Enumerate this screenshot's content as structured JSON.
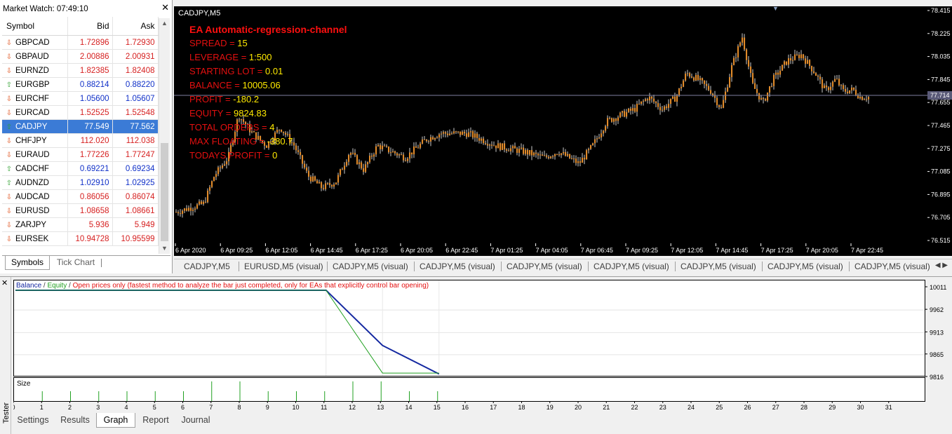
{
  "market_watch": {
    "title": "Market Watch: 07:49:10",
    "columns": {
      "symbol": "Symbol",
      "bid": "Bid",
      "ask": "Ask"
    },
    "rows": [
      {
        "symbol": "GBPCAD",
        "bid": "1.72896",
        "ask": "1.72930",
        "dir": "down",
        "color": "red"
      },
      {
        "symbol": "GBPAUD",
        "bid": "2.00886",
        "ask": "2.00931",
        "dir": "down",
        "color": "red"
      },
      {
        "symbol": "EURNZD",
        "bid": "1.82385",
        "ask": "1.82408",
        "dir": "down",
        "color": "red"
      },
      {
        "symbol": "EURGBP",
        "bid": "0.88214",
        "ask": "0.88220",
        "dir": "up",
        "color": "blue"
      },
      {
        "symbol": "EURCHF",
        "bid": "1.05600",
        "ask": "1.05607",
        "dir": "down",
        "color": "blue"
      },
      {
        "symbol": "EURCAD",
        "bid": "1.52525",
        "ask": "1.52548",
        "dir": "down",
        "color": "red"
      },
      {
        "symbol": "CADJPY",
        "bid": "77.549",
        "ask": "77.562",
        "dir": "up",
        "color": "selected"
      },
      {
        "symbol": "CHFJPY",
        "bid": "112.020",
        "ask": "112.038",
        "dir": "down",
        "color": "red"
      },
      {
        "symbol": "EURAUD",
        "bid": "1.77226",
        "ask": "1.77247",
        "dir": "down",
        "color": "red"
      },
      {
        "symbol": "CADCHF",
        "bid": "0.69221",
        "ask": "0.69234",
        "dir": "up",
        "color": "blue"
      },
      {
        "symbol": "AUDNZD",
        "bid": "1.02910",
        "ask": "1.02925",
        "dir": "up",
        "color": "blue"
      },
      {
        "symbol": "AUDCAD",
        "bid": "0.86056",
        "ask": "0.86074",
        "dir": "down",
        "color": "red"
      },
      {
        "symbol": "EURUSD",
        "bid": "1.08658",
        "ask": "1.08661",
        "dir": "down",
        "color": "red"
      },
      {
        "symbol": "ZARJPY",
        "bid": "5.936",
        "ask": "5.949",
        "dir": "down",
        "color": "red"
      },
      {
        "symbol": "EURSEK",
        "bid": "10.94728",
        "ask": "10.95599",
        "dir": "down",
        "color": "red"
      }
    ],
    "tabs": [
      "Symbols",
      "Tick Chart"
    ]
  },
  "chart": {
    "title": "CADJPY,M5",
    "ea": {
      "title": "EA Automatic-regression-channel",
      "lines": [
        {
          "label": "SPREAD = ",
          "value": "15"
        },
        {
          "label": "LEVERAGE = ",
          "value": "1:500"
        },
        {
          "label": "STARTING LOT = ",
          "value": "0.01"
        },
        {
          "label": "BALANCE = ",
          "value": "10005.06"
        },
        {
          "label": "PROFIT = ",
          "value": "-180.2"
        },
        {
          "label": "EQUITY = ",
          "value": "9824.83"
        },
        {
          "label": "TOTAL ORDERS = ",
          "value": "4"
        },
        {
          "label": "MAX FLOATING = ",
          "value": "-380.7"
        },
        {
          "label": "TODAYS PROFIT = ",
          "value": "0"
        }
      ]
    },
    "current_price": "77.714",
    "price_ticks": [
      "78.415",
      "78.225",
      "78.035",
      "77.845",
      "77.655",
      "77.465",
      "77.275",
      "77.085",
      "76.895",
      "76.705",
      "76.515"
    ],
    "time_ticks": [
      "6 Apr 2020",
      "6 Apr 09:25",
      "6 Apr 12:05",
      "6 Apr 14:45",
      "6 Apr 17:25",
      "6 Apr 20:05",
      "6 Apr 22:45",
      "7 Apr 01:25",
      "7 Apr 04:05",
      "7 Apr 06:45",
      "7 Apr 09:25",
      "7 Apr 12:05",
      "7 Apr 14:45",
      "7 Apr 17:25",
      "7 Apr 20:05",
      "7 Apr 22:45"
    ],
    "tabs": [
      "CADJPY,M5",
      "EURUSD,M5 (visual)",
      "CADJPY,M5 (visual)",
      "CADJPY,M5 (visual)",
      "CADJPY,M5 (visual)",
      "CADJPY,M5 (visual)",
      "CADJPY,M5 (visual)",
      "CADJPY,M5 (visual)",
      "CADJPY,M5 (visual)"
    ],
    "colors": {
      "background": "#000000",
      "candle": "#e08a2a",
      "wick": "#ffffff",
      "price_line": "#8080a0"
    }
  },
  "tester": {
    "label": "Tester",
    "legend": {
      "balance": "Balance",
      "sep1": " / ",
      "equity": "Equity",
      "sep2": " / ",
      "mode": "Open prices only (fastest method to analyze the bar just completed, only for EAs that explicitly control bar opening)"
    },
    "size_label": "Size",
    "y_ticks": [
      "10011",
      "9962",
      "9913",
      "9865",
      "9816"
    ],
    "x_ticks": [
      "0",
      "1",
      "2",
      "3",
      "4",
      "5",
      "6",
      "7",
      "8",
      "9",
      "10",
      "11",
      "12",
      "13",
      "14",
      "15",
      "16",
      "17",
      "18",
      "19",
      "20",
      "21",
      "22",
      "23",
      "24",
      "25",
      "26",
      "27",
      "28",
      "29",
      "30",
      "31"
    ],
    "tabs": [
      "Settings",
      "Results",
      "Graph",
      "Report",
      "Journal"
    ],
    "active_tab": "Graph",
    "colors": {
      "balance": "#1428a0",
      "equity": "#20a020",
      "size": "#20a020"
    }
  },
  "chart_data": {
    "type": "line",
    "title": "",
    "xlabel": "",
    "ylabel": "",
    "x": [
      0,
      11,
      13,
      15
    ],
    "series": [
      {
        "name": "Balance",
        "values": [
          10005,
          10005,
          9885,
          9823
        ]
      },
      {
        "name": "Equity",
        "values": [
          10005,
          10005,
          9825,
          9825
        ]
      }
    ],
    "ylim": [
      9816,
      10011
    ],
    "xlim": [
      0,
      31
    ],
    "size_values": [
      {
        "x": 1,
        "v": 0.01
      },
      {
        "x": 2,
        "v": 0.01
      },
      {
        "x": 3,
        "v": 0.01
      },
      {
        "x": 4,
        "v": 0.01
      },
      {
        "x": 5,
        "v": 0.01
      },
      {
        "x": 6,
        "v": 0.01
      },
      {
        "x": 7,
        "v": 0.02
      },
      {
        "x": 8,
        "v": 0.02
      },
      {
        "x": 9,
        "v": 0.01
      },
      {
        "x": 10,
        "v": 0.01
      },
      {
        "x": 11,
        "v": 0.01
      },
      {
        "x": 12,
        "v": 0.02
      },
      {
        "x": 13,
        "v": 0.02
      },
      {
        "x": 14,
        "v": 0.01
      },
      {
        "x": 15,
        "v": 0.01
      }
    ]
  }
}
